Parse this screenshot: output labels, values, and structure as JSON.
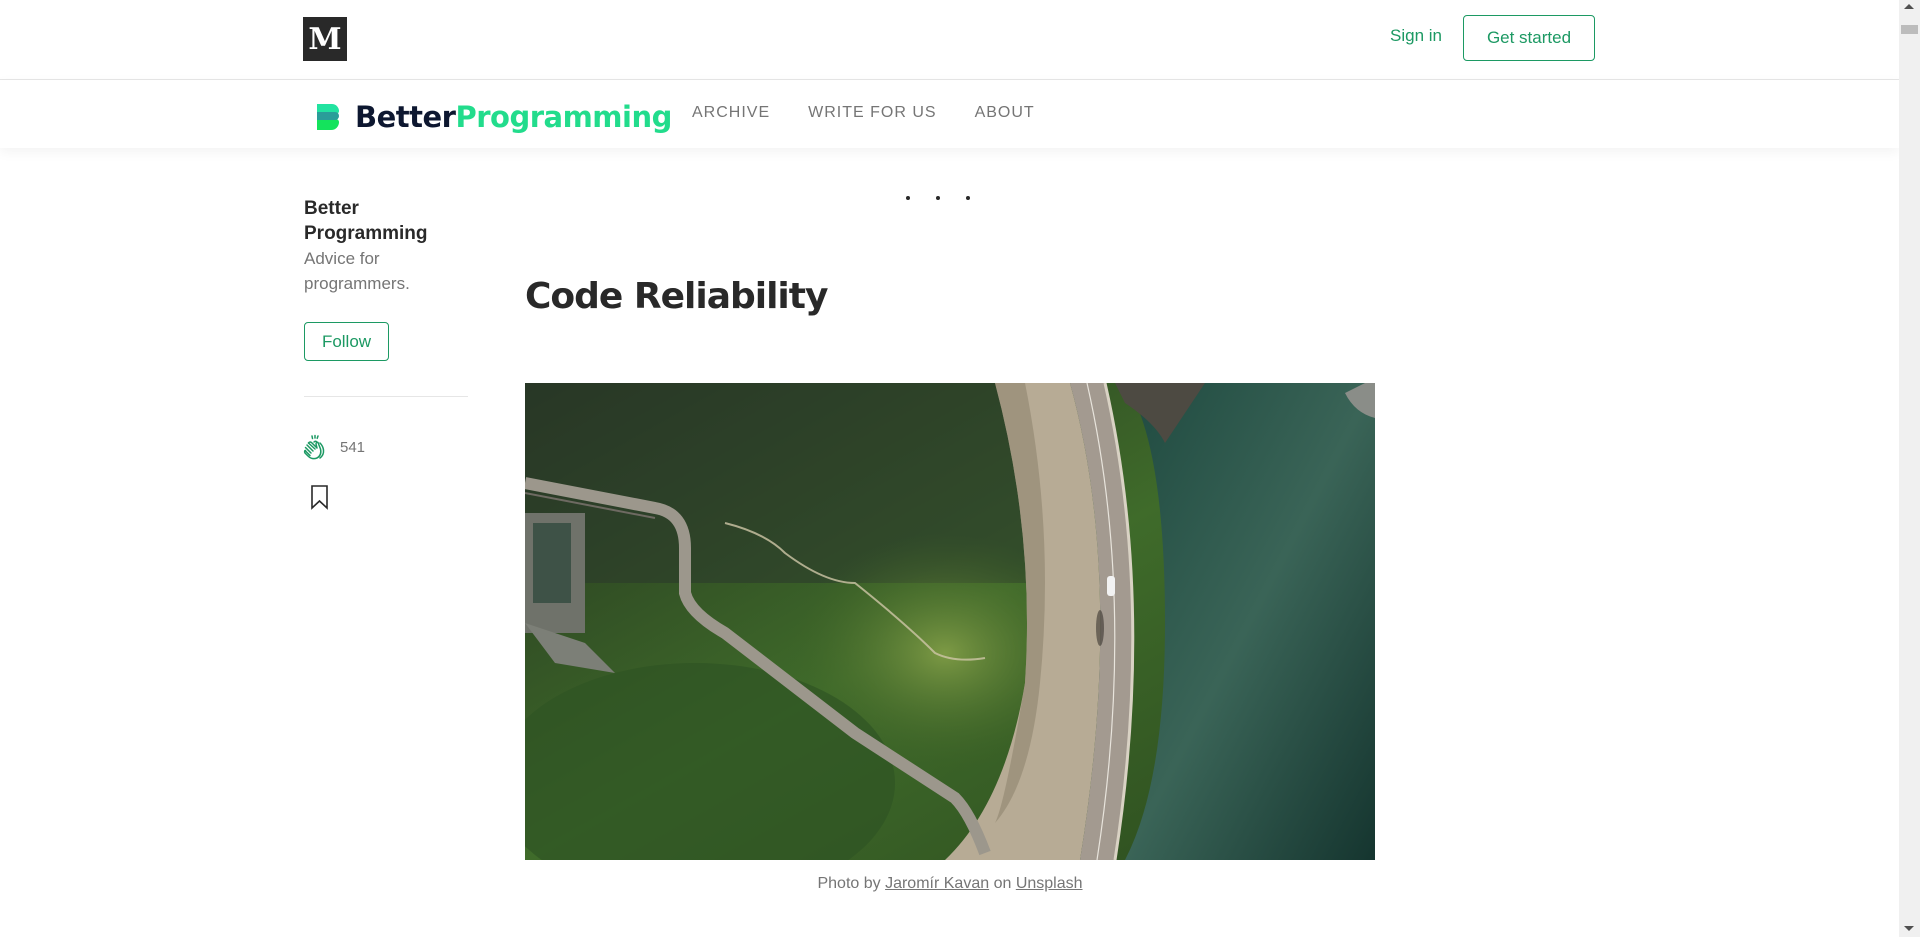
{
  "topbar": {
    "logo_letter": "M",
    "sign_in_label": "Sign in",
    "get_started_label": "Get started"
  },
  "publication": {
    "name_part1": "Better",
    "name_part2": "Programming",
    "nav": [
      {
        "label": "ARCHIVE"
      },
      {
        "label": "WRITE FOR US"
      },
      {
        "label": "ABOUT"
      }
    ]
  },
  "sidebar": {
    "title": "Better Programming",
    "description": "Advice for programmers.",
    "follow_label": "Follow",
    "clap_count": "541"
  },
  "article": {
    "title": "Code Reliability",
    "caption": {
      "prefix": "Photo by ",
      "author": "Jaromír Kavan",
      "middle": " on ",
      "source": "Unsplash"
    }
  },
  "colors": {
    "accent": "#1c9963",
    "brand_dark": "#0d1730",
    "brand_green": "#22dc8c"
  }
}
